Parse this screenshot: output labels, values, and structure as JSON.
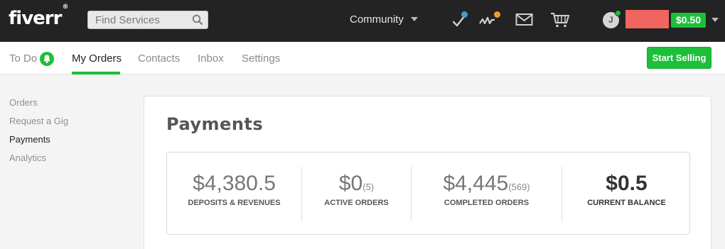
{
  "header": {
    "logo": "fiverr",
    "logo_mark": "®",
    "search_placeholder": "Find Services",
    "community": "Community",
    "avatar_initial": "J",
    "balance": "$0.50",
    "colors": {
      "bar": "#232323",
      "accent": "#1dbf3a",
      "redaction": "#f0655f"
    }
  },
  "nav": {
    "tabs": [
      {
        "label": "To Do"
      },
      {
        "label": "My Orders"
      },
      {
        "label": "Contacts"
      },
      {
        "label": "Inbox"
      },
      {
        "label": "Settings"
      }
    ],
    "active_tab": "My Orders",
    "start_selling": "Start Selling"
  },
  "sidebar": {
    "items": [
      {
        "label": "Orders"
      },
      {
        "label": "Request a Gig"
      },
      {
        "label": "Payments"
      },
      {
        "label": "Analytics"
      }
    ],
    "active_item": "Payments"
  },
  "main": {
    "title": "Payments",
    "stats": [
      {
        "value": "$4,380.5",
        "count": "",
        "label": "DEPOSITS & REVENUES"
      },
      {
        "value": "$0",
        "count": "(5)",
        "label": "ACTIVE ORDERS"
      },
      {
        "value": "$4,445",
        "count": "(569)",
        "label": "COMPLETED ORDERS"
      },
      {
        "value": "$0.5",
        "count": "",
        "label": "CURRENT BALANCE"
      }
    ]
  }
}
